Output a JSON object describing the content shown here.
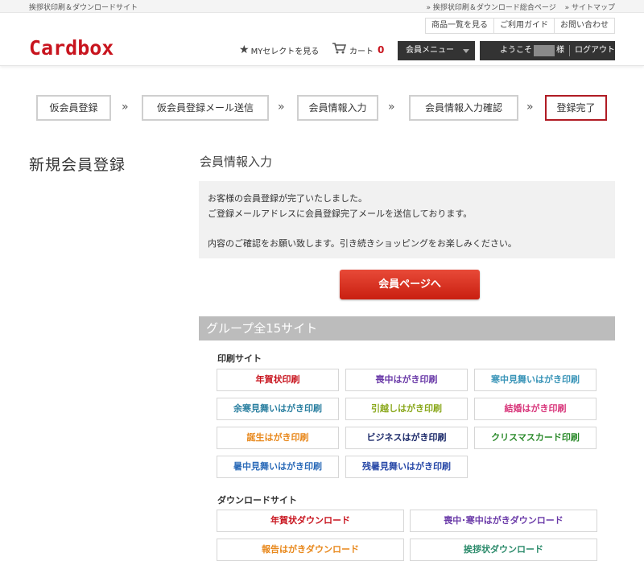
{
  "topbar": {
    "tagline": "挨拶状印刷＆ダウンロードサイト",
    "links": [
      "» 挨拶状印刷＆ダウンロード総合ページ",
      "» サイトマップ"
    ]
  },
  "header": {
    "logo": "Cardbox",
    "util_links": [
      "商品一覧を見る",
      "ご利用ガイド",
      "お問い合わせ"
    ],
    "myselect": "MYセレクトを見る",
    "cart_label": "カート",
    "cart_count": "0",
    "member_menu": "会員メニュー",
    "welcome": "ようこそ",
    "sama": "様",
    "logout": "ログアウト"
  },
  "steps": [
    "仮会員登録",
    "仮会員登録メール送信",
    "会員情報入力",
    "会員情報入力確認",
    "登録完了"
  ],
  "step_arrow": "»",
  "page_title": "新規会員登録",
  "section_title": "会員情報入力",
  "message": {
    "line1": "お客様の会員登録が完了いたしました。",
    "line2": "ご登録メールアドレスに会員登録完了メールを送信しております。",
    "line3": "内容のご確認をお願い致します。引き続きショッピングをお楽しみください。"
  },
  "cta_label": "会員ページへ",
  "group": {
    "title": "グループ全15サイト",
    "print_heading": "印刷サイト",
    "print_sites": [
      {
        "label": "年賀状印刷",
        "color": "#c8141e"
      },
      {
        "label": "喪中はがき印刷",
        "color": "#6a3aa8"
      },
      {
        "label": "寒中見舞いはがき印刷",
        "color": "#3a95b8"
      },
      {
        "label": "余寒見舞いはがき印刷",
        "color": "#2a7fa0"
      },
      {
        "label": "引越しはがき印刷",
        "color": "#8aa81c"
      },
      {
        "label": "結婚はがき印刷",
        "color": "#d8357a"
      },
      {
        "label": "誕生はがき印刷",
        "color": "#e8881c"
      },
      {
        "label": "ビジネスはがき印刷",
        "color": "#1c2a6a"
      },
      {
        "label": "クリスマスカード印刷",
        "color": "#2a8a2a"
      },
      {
        "label": "暑中見舞いはがき印刷",
        "color": "#2a6ab8"
      },
      {
        "label": "残暑見舞いはがき印刷",
        "color": "#2a4aa8"
      }
    ],
    "download_heading": "ダウンロードサイト",
    "download_sites": [
      {
        "label": "年賀状ダウンロード",
        "color": "#c8141e"
      },
      {
        "label": "喪中･寒中はがきダウンロード",
        "color": "#6a3aa8"
      },
      {
        "label": "報告はがきダウンロード",
        "color": "#e8881c"
      },
      {
        "label": "挨拶状ダウンロード",
        "color": "#2a8a6a"
      }
    ]
  },
  "colors": {
    "brand": "#c8141e",
    "dark": "#333333",
    "group_bar": "#bcbcbc",
    "message_bg": "#f1f1f1"
  }
}
